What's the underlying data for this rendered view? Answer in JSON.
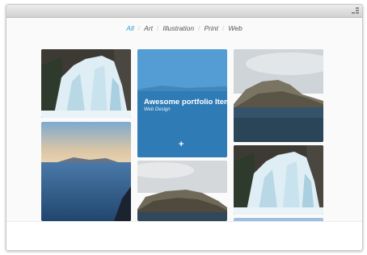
{
  "filters": {
    "items": [
      {
        "label": "All",
        "active": true
      },
      {
        "label": "Art",
        "active": false
      },
      {
        "label": "Illustration",
        "active": false
      },
      {
        "label": "Print",
        "active": false
      },
      {
        "label": "Web",
        "active": false
      }
    ],
    "separator": "/"
  },
  "portfolio": {
    "featured": {
      "title": "Awesome portfolio Item",
      "category": "Web Design",
      "action_icon": "+"
    },
    "items": [
      {
        "icon": "ice-waterfall-photo"
      },
      {
        "icon": "lake-sunset-photo"
      },
      {
        "icon": "coastal-cliff-photo"
      },
      {
        "icon": "coastal-cliff-photo"
      },
      {
        "icon": "ice-waterfall-photo"
      },
      {
        "icon": "sky-photo"
      }
    ]
  },
  "colors": {
    "accent": "#2c9bd4",
    "overlay": "#2882c8"
  }
}
